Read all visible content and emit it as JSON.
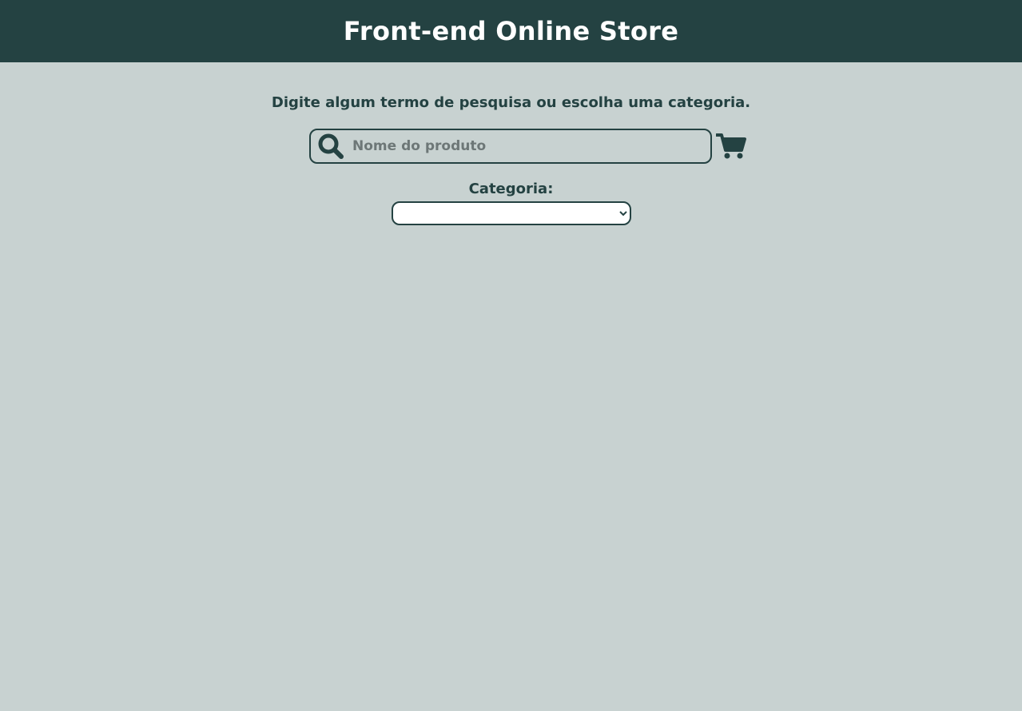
{
  "header": {
    "title": "Front-end Online Store"
  },
  "main": {
    "instruction": "Digite algum termo de pesquisa ou escolha uma categoria.",
    "search": {
      "placeholder": "Nome do produto",
      "value": "",
      "icon": "search-icon"
    },
    "cart": {
      "icon": "cart-icon"
    },
    "category": {
      "label": "Categoria:",
      "selected": ""
    }
  },
  "colors": {
    "header_bg": "#244242",
    "page_bg": "#c8d2d1",
    "accent": "#244242"
  }
}
